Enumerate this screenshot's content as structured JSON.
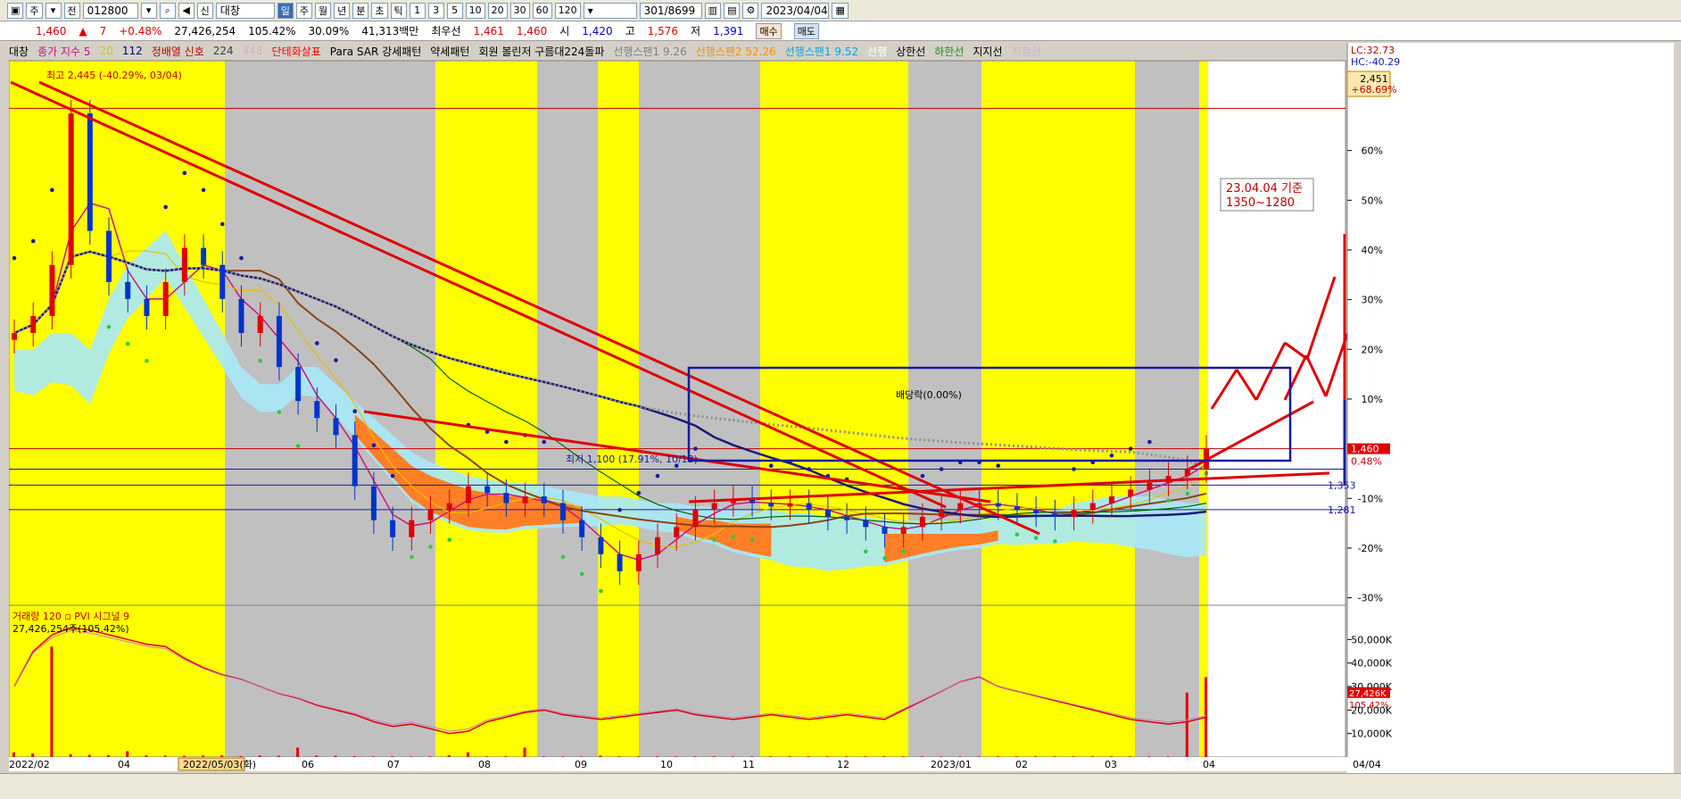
{
  "toolbar": {
    "item_mode": "주",
    "market": "전",
    "code": "012800",
    "name": "대창",
    "periods": [
      "일",
      "주",
      "월",
      "년",
      "분",
      "초",
      "틱"
    ],
    "active_period": "일",
    "minutes": [
      "1",
      "3",
      "5",
      "10",
      "20",
      "30",
      "60",
      "120"
    ],
    "count": "301",
    "total": "/8699",
    "date": "2023/04/04"
  },
  "quote": {
    "price": "1,460",
    "arrow": "▲",
    "change": "7",
    "change_pct": "+0.48%",
    "volume": "27,426,254",
    "volume_ratio": "105.42%",
    "turnover": "30.09%",
    "amount": "41,313백만",
    "pref_label": "최우선",
    "pref_value": "1,461",
    "bid": "1,460",
    "open_label": "시",
    "open_value": "1,420",
    "high_label": "고",
    "high_value": "1,576",
    "low_label": "저",
    "low_value": "1,391",
    "buy_label": "매수",
    "sell_label": "매도"
  },
  "legend": [
    {
      "text": "대창",
      "color": "#000000"
    },
    {
      "text": "종가 지수 5",
      "color": "#c71585"
    },
    {
      "text": "20",
      "color": "#e6c000"
    },
    {
      "text": "112",
      "color": "#000080"
    },
    {
      "text": "정배열 신호",
      "color": "#c00000"
    },
    {
      "text": "224",
      "color": "#404040"
    },
    {
      "text": "448",
      "color": "#d0b0d0"
    },
    {
      "text": "단테화살표",
      "color": "#ff0000"
    },
    {
      "text": "Para SAR 강세패턴",
      "color": "#000000"
    },
    {
      "text": "약세패턴",
      "color": "#000000"
    },
    {
      "text": "회원 볼린저 구름대224돌파",
      "color": "#000000"
    },
    {
      "text": "선행스팬1 9.26",
      "color": "#808080"
    },
    {
      "text": "선행스팬2 52.26",
      "color": "#ff8c00"
    },
    {
      "text": "선행스팬1 9.52",
      "color": "#00aadd"
    },
    {
      "text": "선행",
      "color": "#ffffff"
    },
    {
      "text": "상한선",
      "color": "#000000"
    },
    {
      "text": "하한선",
      "color": "#228b22"
    },
    {
      "text": "지지선",
      "color": "#000000"
    },
    {
      "text": "저항선",
      "color": "#d0b0d0"
    }
  ],
  "right_info": {
    "lc": "LC:32.73",
    "hc": "HC:-40.29",
    "box1": "2,451",
    "box2": "+68.69%",
    "price_tag": "1,460",
    "price_tag_pct": "0.48%",
    "level_1353": "1,353",
    "level_1281": "1,281",
    "vol_tag": "27,426K",
    "vol_tag_pct": "105.42%"
  },
  "annotations": {
    "high_label": "최고 2,445 (-40.29%, 03/04)",
    "low_label": "최저 1,100 (17.91%, 10/13)",
    "dividend_label": "배당락(0.00%)",
    "note_line1": "23.04.04 기준",
    "note_line2": "1350~1280"
  },
  "volume_legend": {
    "line1": "거래량 120 ▫ PVI 시그널 9",
    "line2": "27,426,254주(105.42%)"
  },
  "chart_data": {
    "type": "candlestick",
    "symbol": "대창",
    "period": "2022/02 - 2023/04",
    "price_axis_pct": [
      "60%",
      "50%",
      "40%",
      "30%",
      "20%",
      "10%",
      "0%",
      "-10%",
      "-20%",
      "-30%"
    ],
    "price_axis_pct_values": [
      60,
      50,
      40,
      30,
      20,
      10,
      0,
      -10,
      -20,
      -30
    ],
    "volume_axis": [
      "50,000K",
      "40,000K",
      "30,000K",
      "20,000K",
      "10,000K"
    ],
    "volume_axis_values": [
      50000,
      40000,
      30000,
      20000,
      10000
    ],
    "x_ticks": [
      "2022/02",
      "04",
      "2022/05/03(화)",
      "06",
      "07",
      "08",
      "09",
      "10",
      "11",
      "12",
      "2023/01",
      "02",
      "03",
      "04",
      "04/04"
    ],
    "high": 2445,
    "low": 1100,
    "last": 1460,
    "box_range": [
      1280,
      1350
    ],
    "close_series": [
      1800,
      1850,
      2000,
      2445,
      2100,
      1950,
      1900,
      1850,
      1950,
      2050,
      2000,
      1900,
      1800,
      1850,
      1700,
      1600,
      1550,
      1500,
      1350,
      1250,
      1200,
      1250,
      1280,
      1300,
      1350,
      1330,
      1300,
      1320,
      1300,
      1250,
      1200,
      1150,
      1100,
      1150,
      1200,
      1230,
      1280,
      1300,
      1310,
      1300,
      1290,
      1300,
      1280,
      1260,
      1250,
      1230,
      1210,
      1230,
      1260,
      1280,
      1300,
      1300,
      1290,
      1280,
      1270,
      1260,
      1280,
      1300,
      1320,
      1340,
      1360,
      1380,
      1400,
      1460
    ]
  }
}
